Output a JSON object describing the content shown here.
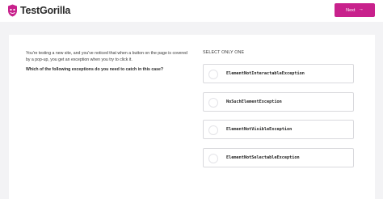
{
  "header": {
    "brand": "TestGorilla",
    "next_label": "Next",
    "next_arrow": "→"
  },
  "question": {
    "text": "You're testing a new site, and you've noticed that when a button on the page is covered by a pop-up, you get an exception when you try to click it.",
    "ask": "Which of the following exceptions do you need to catch in this case?"
  },
  "answers": {
    "instruction": "SELECT ONLY ONE",
    "options": [
      {
        "label": "ElementNotInteractableException"
      },
      {
        "label": "NoSuchElementException"
      },
      {
        "label": "ElementNotVisibleException"
      },
      {
        "label": "ElementNotSelectableException"
      }
    ]
  },
  "colors": {
    "accent": "#c8218c",
    "background": "#f3f3f5"
  }
}
